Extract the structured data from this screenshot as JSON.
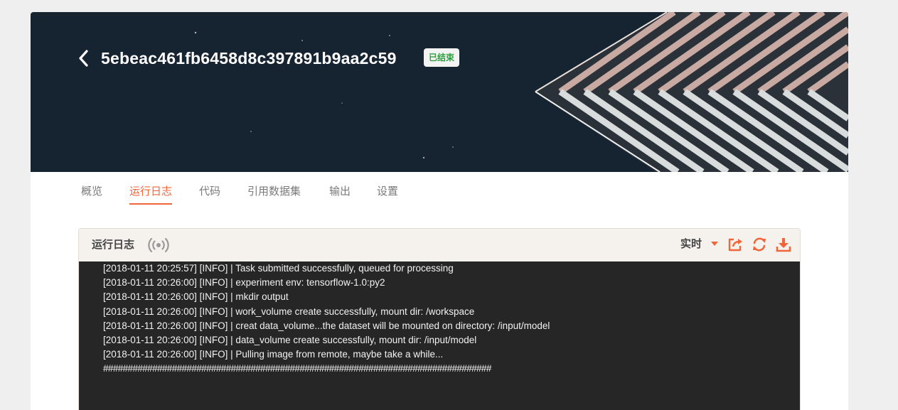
{
  "header": {
    "experiment_id": "5ebeac461fb6458d8c397891b9aa2c59",
    "status": "已结束",
    "status_color": "#2f9e3f"
  },
  "tabs": [
    {
      "label": "概览",
      "active": false
    },
    {
      "label": "运行日志",
      "active": true
    },
    {
      "label": "代码",
      "active": false
    },
    {
      "label": "引用数据集",
      "active": false
    },
    {
      "label": "输出",
      "active": false
    },
    {
      "label": "设置",
      "active": false
    }
  ],
  "log_panel": {
    "title": "运行日志",
    "mode_label": "实时",
    "accent_color": "#f0663a",
    "icons": [
      "broadcast-icon",
      "caret-down-icon",
      "share-icon",
      "refresh-icon",
      "download-icon"
    ],
    "lines": [
      "[2018-01-11 20:25:57] [INFO] | Task submitted successfully, queued for processing",
      "[2018-01-11 20:26:00] [INFO] | experiment env: tensorflow-1.0:py2",
      "[2018-01-11 20:26:00] [INFO] | mkdir output",
      "[2018-01-11 20:26:00] [INFO] | work_volume create successfully, mount dir: /workspace",
      "[2018-01-11 20:26:00] [INFO] | creat data_volume...the dataset will be mounted on directory: /input/model",
      "[2018-01-11 20:26:00] [INFO] | data_volume create successfully, mount dir: /input/model",
      "[2018-01-11 20:26:00] [INFO] | Pulling image from remote, maybe take a while...",
      "###############################################################################"
    ]
  }
}
